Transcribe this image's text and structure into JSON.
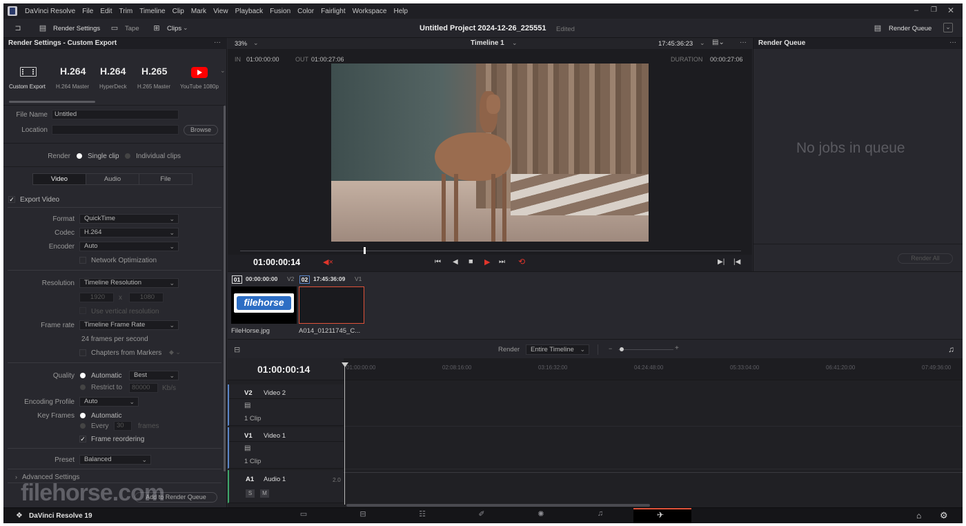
{
  "menu": {
    "app_name": "DaVinci Resolve",
    "items": [
      "File",
      "Edit",
      "Trim",
      "Timeline",
      "Clip",
      "Mark",
      "View",
      "Playback",
      "Fusion",
      "Color",
      "Fairlight",
      "Workspace",
      "Help"
    ]
  },
  "toolbar": {
    "render_settings": "Render Settings",
    "tape": "Tape",
    "clips": "Clips",
    "project_title": "Untitled Project 2024-12-26_225551",
    "project_status": "Edited",
    "render_queue": "Render Queue"
  },
  "render_settings": {
    "title": "Render Settings - Custom Export",
    "presets": [
      {
        "name": "H.264",
        "caption": "H.264 Master"
      },
      {
        "name": "H.264",
        "caption": "HyperDeck"
      },
      {
        "name": "H.265",
        "caption": "H.265 Master"
      },
      {
        "name": "",
        "caption": "YouTube 1080p"
      }
    ],
    "custom_export_caption": "Custom Export",
    "file_name_label": "File Name",
    "file_name_value": "Untitled",
    "location_label": "Location",
    "browse": "Browse",
    "render_label": "Render",
    "single_clip": "Single clip",
    "individual_clips": "Individual clips",
    "tabs": [
      "Video",
      "Audio",
      "File"
    ],
    "export_video": "Export Video",
    "format_label": "Format",
    "format_value": "QuickTime",
    "codec_label": "Codec",
    "codec_value": "H.264",
    "encoder_label": "Encoder",
    "encoder_value": "Auto",
    "network_optimization": "Network Optimization",
    "resolution_label": "Resolution",
    "resolution_value": "Timeline Resolution",
    "res_width": "1920",
    "res_x": "x",
    "res_height": "1080",
    "vertical_resolution": "Use vertical resolution",
    "frame_rate_label": "Frame rate",
    "frame_rate_value": "Timeline Frame Rate",
    "frames_per_second": "24 frames per second",
    "chapters": "Chapters from Markers",
    "quality_label": "Quality",
    "quality_auto": "Automatic",
    "quality_value": "Best",
    "restrict_to": "Restrict to",
    "restrict_value": "80000",
    "restrict_unit": "Kb/s",
    "encoding_profile_label": "Encoding Profile",
    "encoding_profile_value": "Auto",
    "key_frames_label": "Key Frames",
    "key_frames_auto": "Automatic",
    "every": "Every",
    "every_value": "30",
    "frames": "frames",
    "frame_reordering": "Frame reordering",
    "preset_label": "Preset",
    "preset_value": "Balanced",
    "advanced_settings": "Advanced Settings",
    "add_to_queue": "Add to Render Queue"
  },
  "viewer": {
    "zoom": "33%",
    "timeline_name": "Timeline 1",
    "timecode_top": "17:45:36:23",
    "in_label": "IN",
    "in_value": "01:00:00:00",
    "out_label": "OUT",
    "out_value": "01:00:27:06",
    "duration_label": "DURATION",
    "duration_value": "00:00:27:06",
    "current_tc": "01:00:00:14"
  },
  "render_queue": {
    "title": "Render Queue",
    "empty": "No jobs in queue",
    "render_all": "Render All"
  },
  "clips": [
    {
      "index": "01",
      "tc": "00:00:00:00",
      "track": "V2",
      "name": "FileHorse.jpg",
      "logo": "filehorse"
    },
    {
      "index": "02",
      "tc": "17:45:36:09",
      "track": "V1",
      "name": "A014_01211745_C..."
    }
  ],
  "timeline": {
    "render_label": "Render",
    "render_value": "Entire Timeline",
    "current_tc": "01:00:00:14",
    "ruler": [
      "01:00:00:00",
      "02:08:16:00",
      "03:16:32:00",
      "04:24:48:00",
      "05:33:04:00",
      "06:41:20:00",
      "07:49:36:00"
    ],
    "tracks": [
      {
        "id": "V2",
        "name": "Video 2",
        "clips": "1 Clip"
      },
      {
        "id": "V1",
        "name": "Video 1",
        "clips": "1 Clip"
      },
      {
        "id": "A1",
        "name": "Audio 1",
        "level": "2.0",
        "solo": "S",
        "mute": "M"
      }
    ]
  },
  "bottombar": {
    "app_version": "DaVinci Resolve 19"
  },
  "watermark": "filehorse.com",
  "colors": {
    "accent_red": "#e0352b",
    "youtube_red": "#ff0000",
    "selection_orange": "#e0533a",
    "clip_blue": "#5a86c8"
  }
}
